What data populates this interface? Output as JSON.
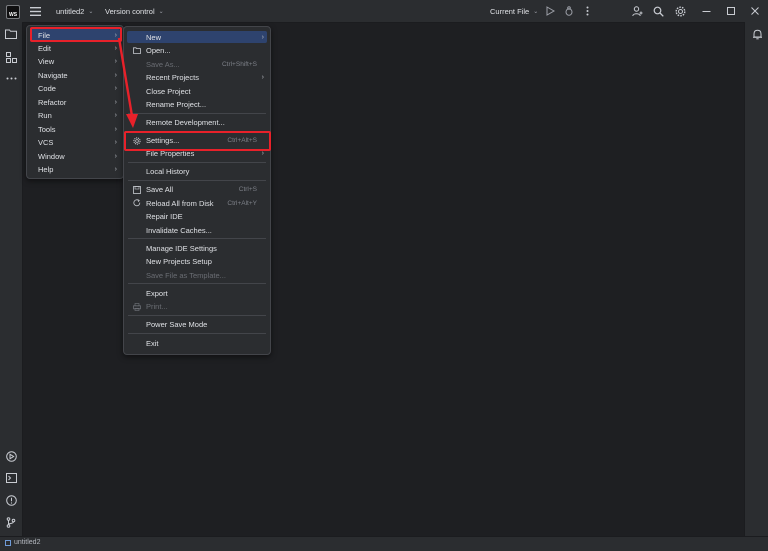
{
  "titlebar": {
    "project": "untitled2",
    "vcs": "Version control",
    "run_config": "Current File"
  },
  "status": {
    "project": "untitled2"
  },
  "main_menu": [
    {
      "label": "File",
      "selected": true
    },
    {
      "label": "Edit"
    },
    {
      "label": "View"
    },
    {
      "label": "Navigate"
    },
    {
      "label": "Code"
    },
    {
      "label": "Refactor"
    },
    {
      "label": "Run"
    },
    {
      "label": "Tools"
    },
    {
      "label": "VCS"
    },
    {
      "label": "Window"
    },
    {
      "label": "Help"
    }
  ],
  "file_menu": {
    "new": "New",
    "open": "Open...",
    "save_as": "Save As...",
    "save_as_shortcut": "Ctrl+Shift+S",
    "recent_projects": "Recent Projects",
    "close_project": "Close Project",
    "rename_project": "Rename Project...",
    "remote_development": "Remote Development...",
    "settings": "Settings...",
    "settings_shortcut": "Ctrl+Alt+S",
    "file_properties": "File Properties",
    "local_history": "Local History",
    "save_all": "Save All",
    "save_all_shortcut": "Ctrl+S",
    "reload_all": "Reload All from Disk",
    "reload_all_shortcut": "Ctrl+Alt+Y",
    "repair_ide": "Repair IDE",
    "invalidate_caches": "Invalidate Caches...",
    "manage_ide_settings": "Manage IDE Settings",
    "new_projects_setup": "New Projects Setup",
    "save_file_as_template": "Save File as Template...",
    "export": "Export",
    "print": "Print...",
    "power_save_mode": "Power Save Mode",
    "exit": "Exit"
  },
  "colors": {
    "background": "#1e1f22",
    "panel": "#2b2d30",
    "selection": "#2e436e",
    "highlight": "#e8212a"
  }
}
